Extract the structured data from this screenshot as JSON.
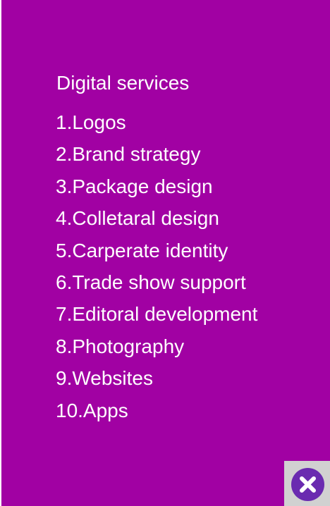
{
  "colors": {
    "panel_background": "#a101a3",
    "text": "#ffffff",
    "close_button": "#6a2bb0",
    "close_area": "#d1d1d1"
  },
  "panel": {
    "title": "Digital services",
    "items": [
      "1.Logos",
      "2.Brand strategy",
      "3.Package design",
      "4.Colletaral design",
      "5.Carperate identity",
      "6.Trade show support",
      "7.Editoral development",
      "8.Photography",
      "9.Websites",
      "10.Apps"
    ]
  },
  "close_button": {
    "icon": "close-icon"
  }
}
